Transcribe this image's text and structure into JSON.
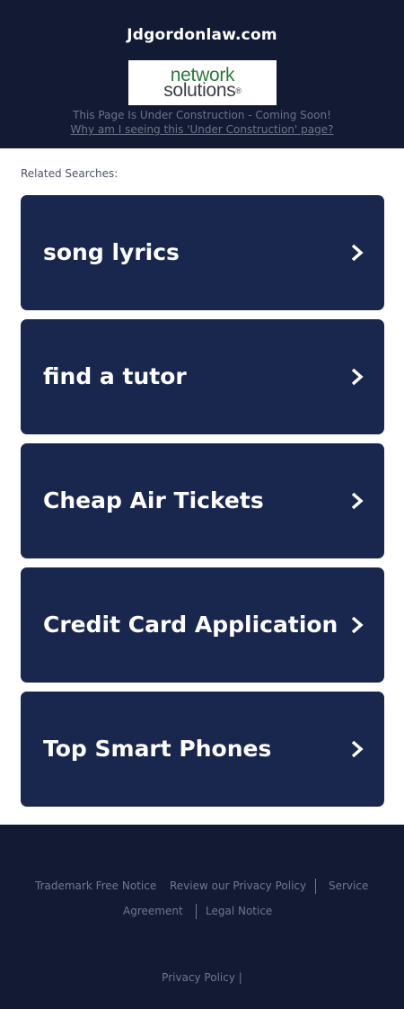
{
  "header": {
    "domain": "Jdgordonlaw.com",
    "logo_line1": "network",
    "logo_line2": "solutions",
    "logo_reg": "®",
    "construction_text": "This Page Is Under Construction - Coming Soon!",
    "construction_link": "Why am I seeing this 'Under Construction' page?"
  },
  "related": {
    "heading": "Related Searches:",
    "items": [
      {
        "label": "song lyrics"
      },
      {
        "label": "find a tutor"
      },
      {
        "label": "Cheap Air Tickets"
      },
      {
        "label": "Credit Card Application"
      },
      {
        "label": "Top Smart Phones"
      }
    ]
  },
  "footer": {
    "trademark": "Trademark Free Notice",
    "privacy_review": "Review our Privacy Policy",
    "service_1": "Service",
    "service_2": "Agreement",
    "legal": "Legal Notice",
    "privacy_policy": "Privacy Policy",
    "privacy_sep": "|"
  },
  "colors": {
    "header_bg": "#131a33",
    "card_bg": "#19264e",
    "logo_green": "#2d7a3a"
  }
}
